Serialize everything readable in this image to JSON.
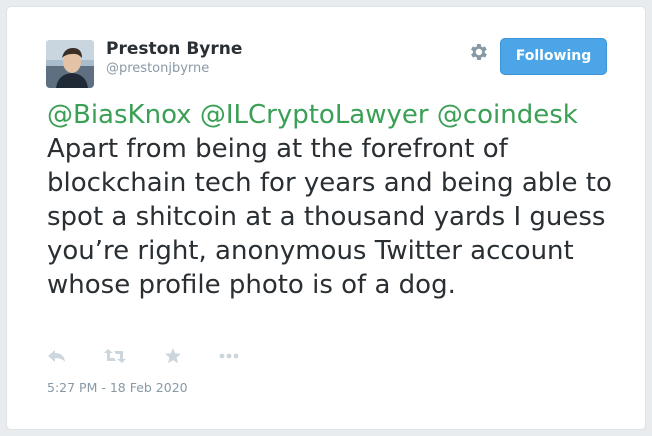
{
  "author": {
    "name": "Preston Byrne",
    "handle": "@prestonjbyrne",
    "avatar_icon": "profile-photo"
  },
  "follow_button": {
    "label": "Following",
    "color": "#4ba5e6"
  },
  "settings_icon": "gear-icon",
  "tweet": {
    "mentions": [
      "@BiasKnox",
      "@ILCryptoLawyer",
      "@coindesk"
    ],
    "body": "Apart from being at the forefront of blockchain tech for years and being able to spot a shitcoin at a thousand yards I guess you’re right, anonymous Twitter account whose profile photo is of a dog.",
    "mention_color": "#3aa055"
  },
  "actions": [
    {
      "name": "reply-icon"
    },
    {
      "name": "retweet-icon"
    },
    {
      "name": "favorite-icon"
    },
    {
      "name": "more-icon"
    }
  ],
  "timestamp": "5:27 PM - 18 Feb 2020"
}
